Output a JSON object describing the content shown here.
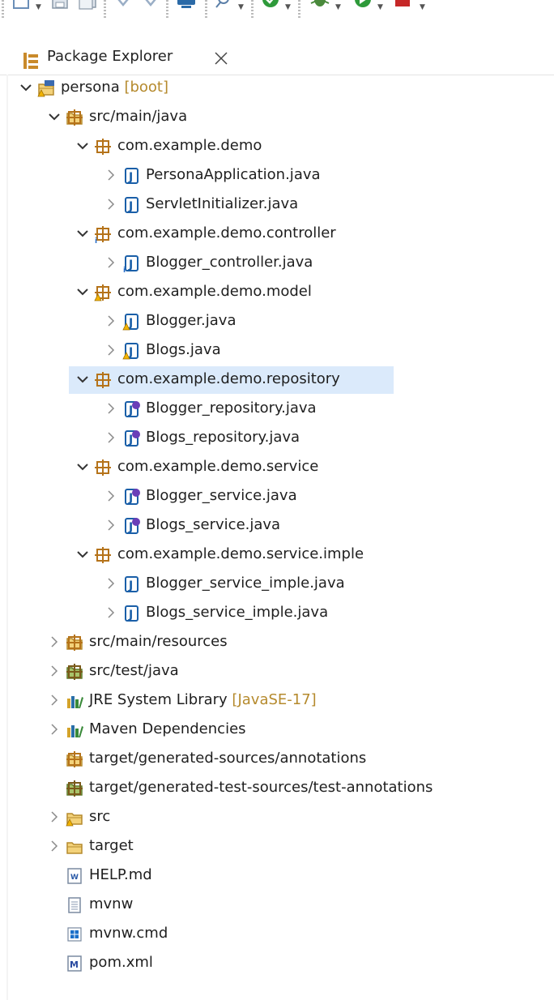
{
  "view": {
    "title": "Package Explorer",
    "close_icon": "close-icon",
    "icon": "package-explorer-icon"
  },
  "toolbar": {
    "icons": [
      "new-icon",
      "save-icon",
      "save-all-icon",
      "back-icon",
      "forward-icon",
      "terminal-icon",
      "search-icon",
      "coverage-icon",
      "debug-icon",
      "run-icon",
      "external-tools-icon"
    ]
  },
  "tree": [
    {
      "label": "persona",
      "decoration": " [boot]",
      "icon": "maven-project-icon",
      "expanded": true,
      "level": 0
    },
    {
      "label": "src/main/java",
      "icon": "source-folder-icon",
      "expanded": true,
      "level": 1
    },
    {
      "label": "com.example.demo",
      "icon": "package-icon",
      "expanded": true,
      "level": 2
    },
    {
      "label": "PersonaApplication.java",
      "icon": "java-file-icon",
      "expanded": false,
      "level": 3
    },
    {
      "label": "ServletInitializer.java",
      "icon": "java-file-icon",
      "expanded": false,
      "level": 3
    },
    {
      "label": "com.example.demo.controller",
      "icon": "package-info-icon",
      "expanded": true,
      "level": 2
    },
    {
      "label": "Blogger_controller.java",
      "icon": "java-file-info-icon",
      "expanded": false,
      "level": 3
    },
    {
      "label": "com.example.demo.model",
      "icon": "package-warning-icon",
      "expanded": true,
      "level": 2
    },
    {
      "label": "Blogger.java",
      "icon": "java-file-warning-icon",
      "expanded": false,
      "level": 3
    },
    {
      "label": "Blogs.java",
      "icon": "java-file-warning-icon",
      "expanded": false,
      "level": 3
    },
    {
      "label": "com.example.demo.repository",
      "icon": "package-icon",
      "expanded": true,
      "level": 2,
      "selected": true
    },
    {
      "label": "Blogger_repository.java",
      "icon": "java-interface-icon",
      "expanded": false,
      "level": 3
    },
    {
      "label": "Blogs_repository.java",
      "icon": "java-interface-icon",
      "expanded": false,
      "level": 3
    },
    {
      "label": "com.example.demo.service",
      "icon": "package-icon",
      "expanded": true,
      "level": 2
    },
    {
      "label": "Blogger_service.java",
      "icon": "java-interface-icon",
      "expanded": false,
      "level": 3
    },
    {
      "label": "Blogs_service.java",
      "icon": "java-interface-icon",
      "expanded": false,
      "level": 3
    },
    {
      "label": "com.example.demo.service.imple",
      "icon": "package-icon",
      "expanded": true,
      "level": 2
    },
    {
      "label": "Blogger_service_imple.java",
      "icon": "java-file-icon",
      "expanded": false,
      "level": 3
    },
    {
      "label": "Blogs_service_imple.java",
      "icon": "java-file-icon",
      "expanded": false,
      "level": 3
    },
    {
      "label": "src/main/resources",
      "icon": "resource-folder-icon",
      "expanded": false,
      "level": 1
    },
    {
      "label": "src/test/java",
      "icon": "test-folder-icon",
      "expanded": false,
      "level": 1
    },
    {
      "label": "JRE System Library",
      "decoration": " [JavaSE-17]",
      "icon": "library-icon",
      "expanded": false,
      "level": 1
    },
    {
      "label": "Maven Dependencies",
      "icon": "library-icon",
      "expanded": false,
      "level": 1
    },
    {
      "label": "target/generated-sources/annotations",
      "icon": "source-folder-icon",
      "level": 1,
      "no_twist": true
    },
    {
      "label": "target/generated-test-sources/test-annotations",
      "icon": "test-folder-icon",
      "level": 1,
      "no_twist": true
    },
    {
      "label": "src",
      "icon": "folder-warning-icon",
      "expanded": false,
      "level": 1
    },
    {
      "label": "target",
      "icon": "folder-icon",
      "expanded": false,
      "level": 1
    },
    {
      "label": "HELP.md",
      "icon": "markdown-file-icon",
      "level": 1,
      "no_twist": true
    },
    {
      "label": "mvnw",
      "icon": "text-file-icon",
      "level": 1,
      "no_twist": true
    },
    {
      "label": "mvnw.cmd",
      "icon": "cmd-file-icon",
      "level": 1,
      "no_twist": true
    },
    {
      "label": "pom.xml",
      "icon": "maven-pom-icon",
      "level": 1,
      "no_twist": true
    }
  ],
  "colors": {
    "selection": "#dbeafb",
    "decoration": "#b58a2d",
    "package": "#b5731a",
    "java": "#1a5fa8"
  }
}
